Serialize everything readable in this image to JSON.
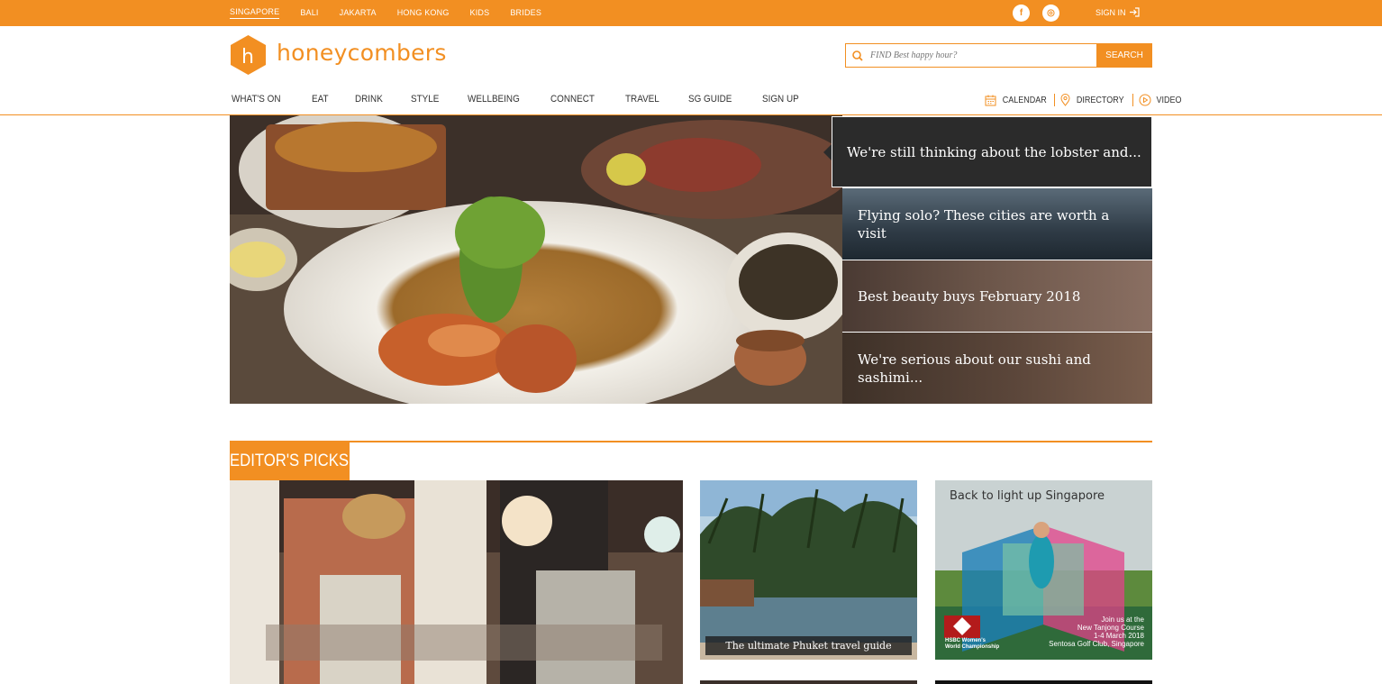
{
  "topbar": {
    "cities": [
      "SINGAPORE",
      "BALI",
      "JAKARTA",
      "HONG KONG",
      "KIDS",
      "BRIDES"
    ],
    "active_city": "SINGAPORE",
    "social": {
      "facebook": "f",
      "instagram": "◎"
    },
    "signin_label": "SIGN IN",
    "signin_icon": "login-arrow-icon",
    "color": "#f28f22"
  },
  "header": {
    "logo_letter": "h",
    "logo_text": "honeycombers",
    "search": {
      "placeholder": "FIND Best happy hour?",
      "button": "SEARCH"
    }
  },
  "nav": {
    "items": [
      "WHAT'S ON",
      "EAT",
      "DRINK",
      "STYLE",
      "WELLBEING",
      "CONNECT",
      "TRAVEL",
      "SG GUIDE",
      "SIGN UP"
    ],
    "utils": [
      {
        "label": "CALENDAR",
        "icon": "calendar-icon"
      },
      {
        "label": "DIRECTORY",
        "icon": "map-pin-icon"
      },
      {
        "label": "VIDEO",
        "icon": "play-icon"
      }
    ]
  },
  "hero": {
    "image": "lobster-dish-photo",
    "active_headline": "We're still thinking about the lobster and...",
    "side_headlines": [
      "Flying solo? These cities are worth a visit",
      "Best beauty buys February 2018",
      "We're serious about our sushi and sashimi..."
    ]
  },
  "editors_picks": {
    "label": "EDITOR'S PICKS",
    "cards": [
      {
        "image": "restaurant-interior-photo",
        "caption": ""
      },
      {
        "image": "phuket-pool-photo",
        "caption": "The ultimate Phuket travel guide"
      }
    ],
    "ad": {
      "headline": "Back to light up Singapore",
      "body": [
        "Join us at the",
        "New Tanjong Course",
        "1-4 March 2018",
        "Sentosa Golf Club, Singapore"
      ],
      "brand": [
        "HSBC Women's",
        "World Championship"
      ]
    }
  }
}
